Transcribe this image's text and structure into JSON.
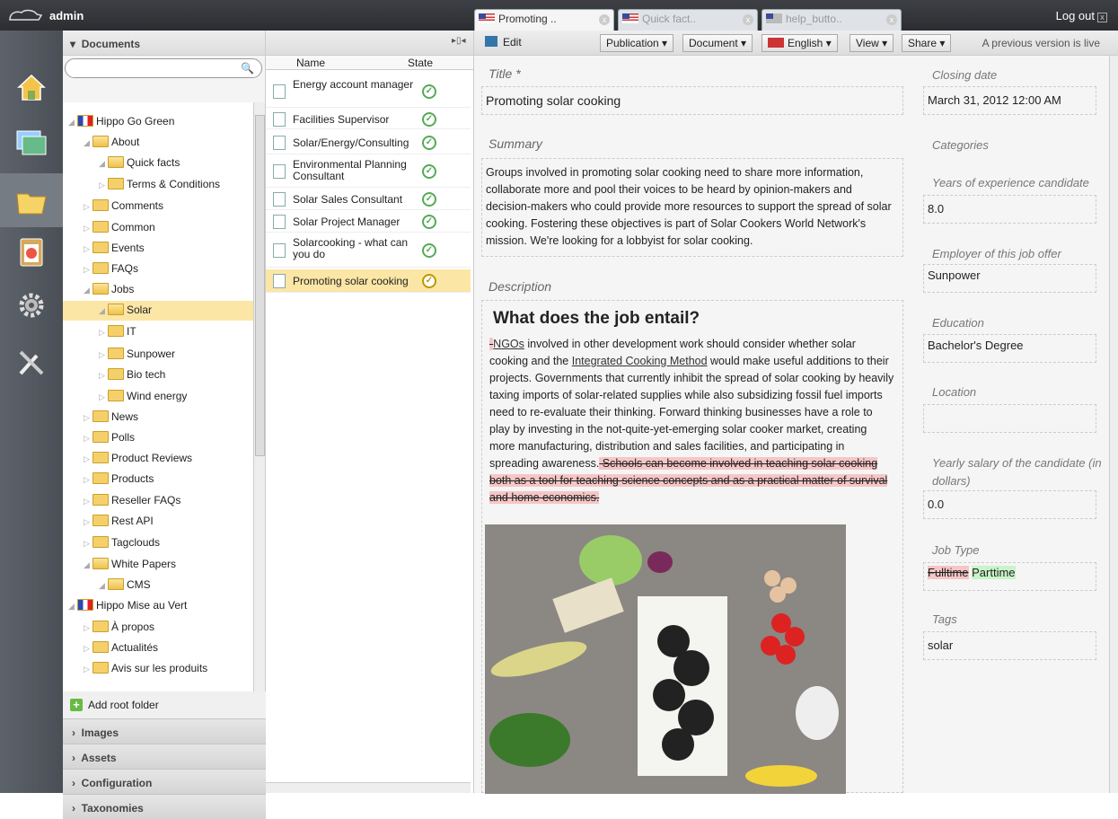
{
  "topbar": {
    "user": "admin",
    "logout": "Log out",
    "close_glyph": "x"
  },
  "tabs": [
    {
      "label": "Promoting ..",
      "active": true
    },
    {
      "label": "Quick fact..",
      "active": false
    },
    {
      "label": "help_butto..",
      "active": false
    }
  ],
  "rail": [
    "home-icon",
    "gallery-icon",
    "documents-icon",
    "reports-icon",
    "settings-icon",
    "admin-tools-icon"
  ],
  "docpanel": {
    "title": "Documents",
    "search": {
      "value": "",
      "placeholder": ""
    },
    "tree": [
      {
        "label": "Hippo Go Green",
        "level": 0,
        "open": true
      },
      {
        "label": "About",
        "level": 1,
        "open": true
      },
      {
        "label": "Quick facts",
        "level": 2,
        "open": true
      },
      {
        "label": "Terms & Conditions",
        "level": 2,
        "open": false
      },
      {
        "label": "Comments",
        "level": 1,
        "open": false
      },
      {
        "label": "Common",
        "level": 1,
        "open": false
      },
      {
        "label": "Events",
        "level": 1,
        "open": false
      },
      {
        "label": "FAQs",
        "level": 1,
        "open": false
      },
      {
        "label": "Jobs",
        "level": 1,
        "open": true
      },
      {
        "label": "Solar",
        "level": 2,
        "open": true,
        "selected": true
      },
      {
        "label": "IT",
        "level": 2,
        "open": false
      },
      {
        "label": "Sunpower",
        "level": 2,
        "open": false
      },
      {
        "label": "Bio tech",
        "level": 2,
        "open": false
      },
      {
        "label": "Wind energy",
        "level": 2,
        "open": false
      },
      {
        "label": "News",
        "level": 1,
        "open": false
      },
      {
        "label": "Polls",
        "level": 1,
        "open": false
      },
      {
        "label": "Product Reviews",
        "level": 1,
        "open": false
      },
      {
        "label": "Products",
        "level": 1,
        "open": false
      },
      {
        "label": "Reseller FAQs",
        "level": 1,
        "open": false
      },
      {
        "label": "Rest API",
        "level": 1,
        "open": false
      },
      {
        "label": "Tagclouds",
        "level": 1,
        "open": false
      },
      {
        "label": "White Papers",
        "level": 1,
        "open": true
      },
      {
        "label": "CMS",
        "level": 2,
        "open": true
      },
      {
        "label": "Hippo Mise au Vert",
        "level": 0,
        "open": true
      },
      {
        "label": "À propos",
        "level": 1,
        "open": false
      },
      {
        "label": "Actualités",
        "level": 1,
        "open": false
      },
      {
        "label": "Avis sur les produits",
        "level": 1,
        "open": false
      }
    ],
    "add_root": "Add root folder",
    "sections": [
      "Images",
      "Assets",
      "Configuration",
      "Taxonomies"
    ]
  },
  "list": {
    "col_name": "Name",
    "col_state": "State",
    "items": [
      {
        "name": "Energy account manager"
      },
      {
        "name": "Facilities Supervisor"
      },
      {
        "name": "Solar/Energy/Consulting"
      },
      {
        "name": "Environmental Planning Consultant"
      },
      {
        "name": "Solar Sales Consultant"
      },
      {
        "name": "Solar Project Manager"
      },
      {
        "name": "Solarcooking - what can you do"
      },
      {
        "name": "Promoting solar cooking",
        "selected": true
      }
    ],
    "state_glyph": "✓"
  },
  "editor": {
    "toolbar": {
      "edit": "Edit",
      "publication": "Publication",
      "document": "Document",
      "language": "English",
      "view": "View",
      "share": "Share",
      "live_msg": "A previous version is live"
    },
    "title_label": "Title *",
    "title_value": "Promoting solar cooking",
    "summary_label": "Summary",
    "summary_value": "Groups involved in promoting solar cooking need to share more information, collaborate more and pool their voices to be heard by opinion-makers and decision-makers who could provide more resources to support the spread of solar cooking. Fostering these objectives is part of Solar Cookers World Network's mission. We're looking for a lobbyist for solar cooking.",
    "description_label": "Description",
    "desc_heading": "What does the job entail?",
    "desc_p_del_lead": "-",
    "desc_p_link1": "NGOs",
    "desc_p_a": " involved in other development work should consider whether solar cooking and the ",
    "desc_p_link2": "Integrated Cooking Method",
    "desc_p_b": " would make useful additions to their projects. Governments that currently inhibit the spread of solar cooking by heavily taxing imports of solar-related supplies while also subsidizing fossil fuel imports need to re-evaluate their thinking. Forward thinking businesses have a role to play by investing in the not-quite-yet-emerging solar cooker market, creating more manufacturing, distribution and sales facilities, and participating in spreading awareness.",
    "desc_p_deleted": " Schools can become involved in teaching solar cooking  both as a tool for teaching science concepts and as a practical matter of survival and home economics.",
    "right": {
      "closing_label": "Closing date",
      "closing_value": "March 31, 2012 12:00 AM",
      "categories_label": "Categories",
      "years_label": "Years of experience candidate",
      "years_value": "8.0",
      "employer_label": "Employer of this job offer",
      "employer_value": "Sunpower",
      "education_label": "Education",
      "education_value": "Bachelor's Degree",
      "location_label": "Location",
      "location_value": "",
      "salary_label": "Yearly salary of the candidate (in dollars)",
      "salary_value": "0.0",
      "jobtype_label": "Job Type",
      "jobtype_old": "Fulltime",
      "jobtype_new": "Parttime",
      "tags_label": "Tags",
      "tags_value": "solar"
    }
  }
}
